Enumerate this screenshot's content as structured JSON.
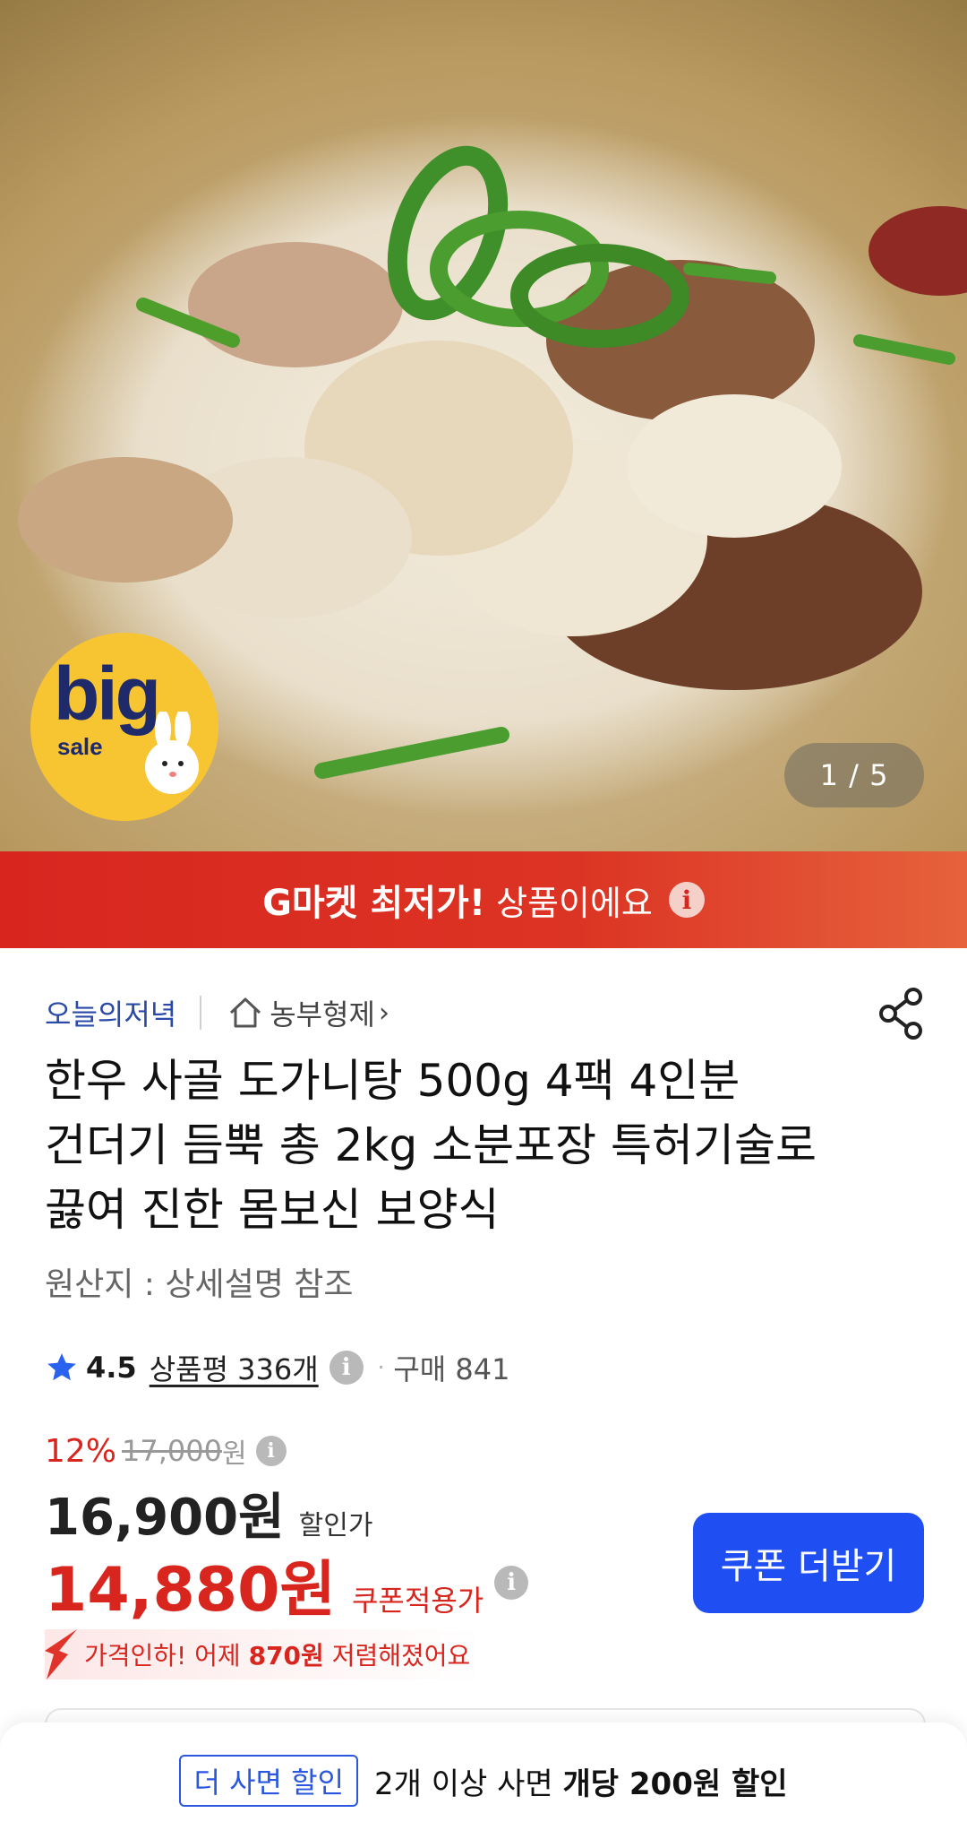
{
  "hero": {
    "page_indicator": "1 / 5",
    "badge": {
      "big": "big",
      "sale": "sale"
    }
  },
  "banner": {
    "strong": "G마켓 최저가!",
    "normal": "상품이에요",
    "info_icon": "info-icon"
  },
  "store": {
    "link": "오늘의저녁",
    "seller": "농부형제",
    "chevron": "›"
  },
  "product": {
    "title": "한우 사골 도가니탕 500g 4팩 4인분 건더기 듬뿍 총 2kg 소분포장 특허기술로 끓여 진한 몸보신 보양식",
    "origin": "원산지 : 상세설명 참조"
  },
  "rating": {
    "score": "4.5",
    "reviews": "상품평 336개",
    "purchase": "구매 841"
  },
  "price": {
    "discount_rate": "12%",
    "original": "17,000",
    "original_won": "원",
    "sale": "16,900원",
    "sale_label": "할인가",
    "coupon": "14,880원",
    "coupon_label": "쿠폰적용가",
    "coupon_button": "쿠폰 더받기",
    "drop_prefix": "가격인하! 어제 ",
    "drop_amount": "870원",
    "drop_suffix": " 저렴해졌어요"
  },
  "bottom_sheet": {
    "tag": "더 사면 할인",
    "text_prefix": "2개 이상 사면 ",
    "text_bold": "개당 200원 할인"
  },
  "colors": {
    "accent_red": "#d8261f",
    "accent_blue": "#1f4ff2",
    "store_link": "#2a4aa8"
  }
}
